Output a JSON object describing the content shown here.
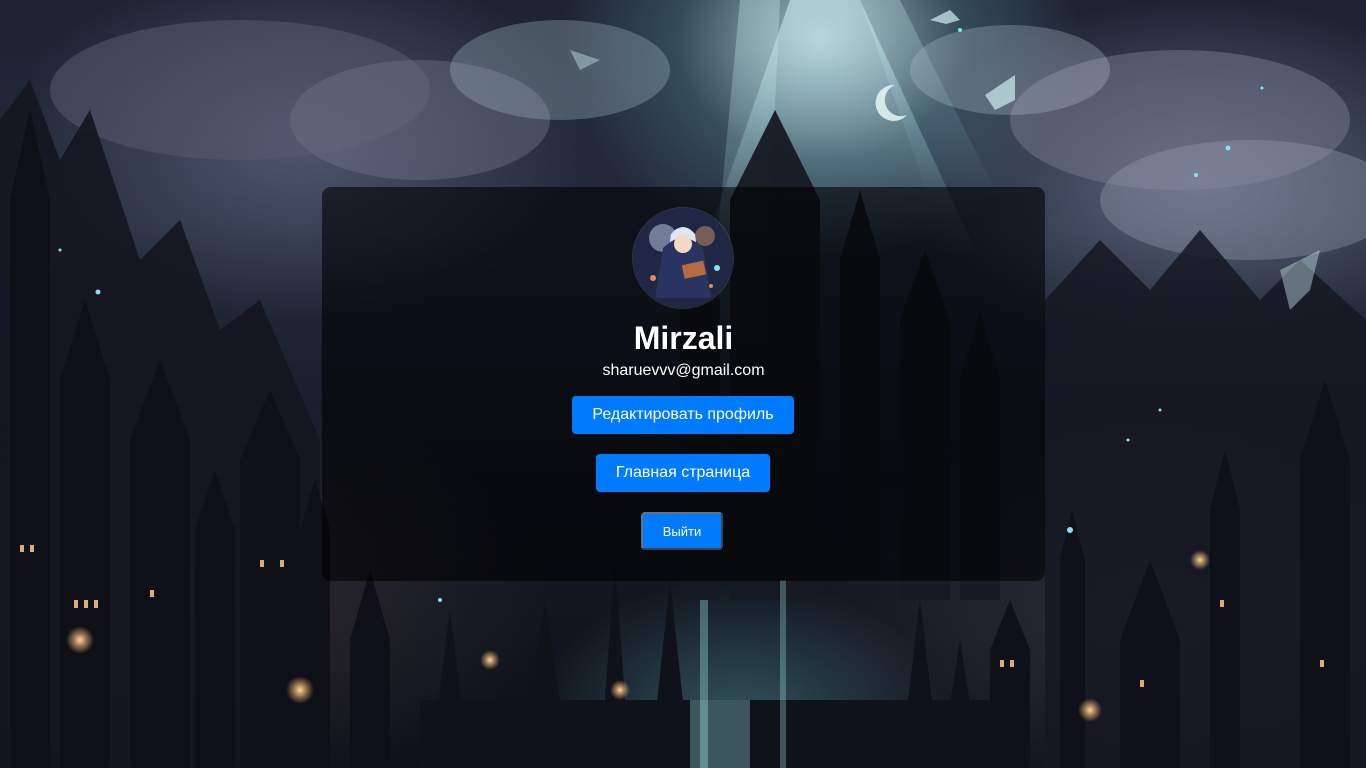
{
  "profile": {
    "username": "Mirzali",
    "email": "sharuevvv@gmail.com"
  },
  "actions": {
    "edit_profile_label": "Редактировать профиль",
    "home_label": "Главная страница",
    "logout_label": "Выйти"
  },
  "colors": {
    "button_background": "#007bff",
    "button_text": "#ffffff",
    "card_background": "rgba(0,0,0,0.58)"
  }
}
